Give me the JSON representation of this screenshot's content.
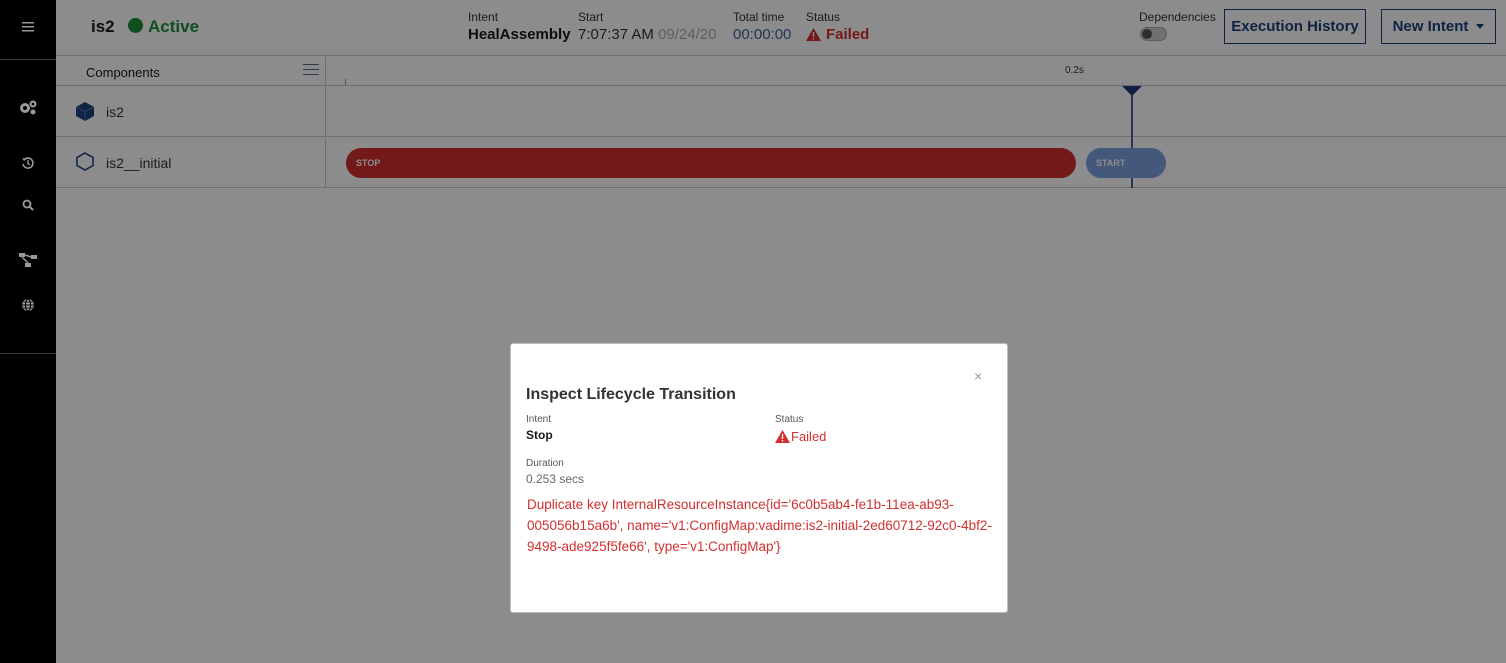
{
  "header": {
    "assembly_name": "is2",
    "assembly_status": "Active",
    "intent_label": "Intent",
    "intent_value": "HealAssembly",
    "start_label": "Start",
    "start_time": "7:07:37 AM",
    "start_date": "09/24/20",
    "total_time_label": "Total time",
    "total_time_value": "00:00:00",
    "status_label": "Status",
    "status_value": "Failed",
    "dependencies_label": "Dependencies",
    "execution_history_label": "Execution History",
    "new_intent_label": "New Intent"
  },
  "sidebar": {
    "items": [
      {
        "icon": "hamburger-menu-icon"
      },
      {
        "icon": "gears-icon"
      },
      {
        "icon": "history-icon"
      },
      {
        "icon": "search-icon"
      },
      {
        "icon": "topology-icon"
      },
      {
        "icon": "globe-icon"
      }
    ]
  },
  "components": {
    "title": "Components",
    "tick_label": "0.2s",
    "rows": [
      {
        "name": "is2",
        "icon": "cube-filled-icon"
      },
      {
        "name": "is2__initial",
        "icon": "cube-outline-icon"
      }
    ],
    "bars": {
      "stop_label": "STOP",
      "start_label": "START"
    }
  },
  "modal": {
    "title": "Inspect Lifecycle Transition",
    "close_label": "×",
    "intent_label": "Intent",
    "intent_value": "Stop",
    "status_label": "Status",
    "status_value": "Failed",
    "duration_label": "Duration",
    "duration_value": "0.253 secs",
    "error_message": "Duplicate key InternalResourceInstance{id='6c0b5ab4-fe1b-11ea-ab93-005056b15a6b', name='v1:ConfigMap:vadime:is2-initial-2ed60712-92c0-4bf2-9498-ade925f5fe66', type='v1:ConfigMap'}"
  },
  "colors": {
    "active": "#1e8c3a",
    "failed": "#d32f2f",
    "primary": "#1e3f7a",
    "start_bar": "#7aa0e0"
  }
}
